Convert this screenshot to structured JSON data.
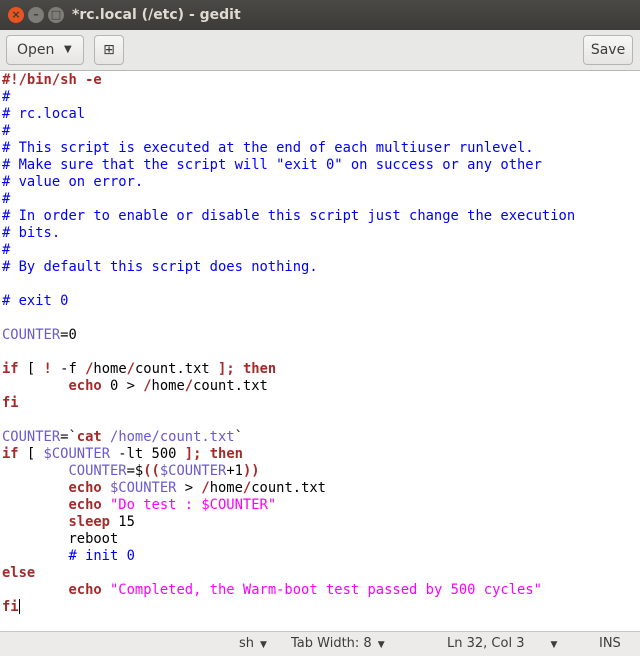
{
  "window": {
    "title": "*rc.local (/etc) - gedit",
    "close_glyph": "×",
    "min_glyph": "–",
    "max_glyph": "□"
  },
  "headerbar": {
    "open_label": "Open",
    "open_arrow": "▼",
    "new_tab_glyph": "⊞",
    "save_label": "Save"
  },
  "editor": {
    "lines": [
      [
        {
          "t": "#!/bin/sh -e",
          "c": "keyword"
        }
      ],
      [
        {
          "t": "#",
          "c": "comment"
        }
      ],
      [
        {
          "t": "# rc.local",
          "c": "comment"
        }
      ],
      [
        {
          "t": "#",
          "c": "comment"
        }
      ],
      [
        {
          "t": "# This script is executed at the end of each multiuser runlevel.",
          "c": "comment"
        }
      ],
      [
        {
          "t": "# Make sure that the script will \"exit 0\" on success or any other",
          "c": "comment"
        }
      ],
      [
        {
          "t": "# value on error.",
          "c": "comment"
        }
      ],
      [
        {
          "t": "#",
          "c": "comment"
        }
      ],
      [
        {
          "t": "# In order to enable or disable this script just change the execution",
          "c": "comment"
        }
      ],
      [
        {
          "t": "# bits.",
          "c": "comment"
        }
      ],
      [
        {
          "t": "#",
          "c": "comment"
        }
      ],
      [
        {
          "t": "# By default this script does nothing.",
          "c": "comment"
        }
      ],
      [],
      [
        {
          "t": "# exit 0",
          "c": "comment"
        }
      ],
      [],
      [
        {
          "t": "COUNTER",
          "c": "variable"
        },
        {
          "t": "=0",
          "c": "plain"
        }
      ],
      [],
      [
        {
          "t": "if",
          "c": "keyword"
        },
        {
          "t": " [ ",
          "c": "plain"
        },
        {
          "t": "!",
          "c": "keyword"
        },
        {
          "t": " -f ",
          "c": "plain"
        },
        {
          "t": "/",
          "c": "keyword"
        },
        {
          "t": "home",
          "c": "plain"
        },
        {
          "t": "/",
          "c": "keyword"
        },
        {
          "t": "count.txt ",
          "c": "plain"
        },
        {
          "t": "];",
          "c": "keyword"
        },
        {
          "t": " ",
          "c": "plain"
        },
        {
          "t": "then",
          "c": "keyword"
        }
      ],
      [
        {
          "t": "        ",
          "c": "plain"
        },
        {
          "t": "echo",
          "c": "keyword"
        },
        {
          "t": " 0 > ",
          "c": "plain"
        },
        {
          "t": "/",
          "c": "keyword"
        },
        {
          "t": "home",
          "c": "plain"
        },
        {
          "t": "/",
          "c": "keyword"
        },
        {
          "t": "count.txt",
          "c": "plain"
        }
      ],
      [
        {
          "t": "fi",
          "c": "keyword"
        }
      ],
      [],
      [
        {
          "t": "COUNTER",
          "c": "variable"
        },
        {
          "t": "=`",
          "c": "plain"
        },
        {
          "t": "cat",
          "c": "keyword"
        },
        {
          "t": " /home/count.txt",
          "c": "variable"
        },
        {
          "t": "`",
          "c": "plain"
        }
      ],
      [
        {
          "t": "if",
          "c": "keyword"
        },
        {
          "t": " [ ",
          "c": "plain"
        },
        {
          "t": "$COUNTER",
          "c": "variable"
        },
        {
          "t": " -lt 500 ",
          "c": "plain"
        },
        {
          "t": "];",
          "c": "keyword"
        },
        {
          "t": " ",
          "c": "plain"
        },
        {
          "t": "then",
          "c": "keyword"
        }
      ],
      [
        {
          "t": "        ",
          "c": "plain"
        },
        {
          "t": "COUNTER",
          "c": "variable"
        },
        {
          "t": "=$",
          "c": "plain"
        },
        {
          "t": "((",
          "c": "keyword"
        },
        {
          "t": "$COUNTER",
          "c": "variable"
        },
        {
          "t": "+1",
          "c": "plain"
        },
        {
          "t": "))",
          "c": "keyword"
        }
      ],
      [
        {
          "t": "        ",
          "c": "plain"
        },
        {
          "t": "echo",
          "c": "keyword"
        },
        {
          "t": " ",
          "c": "plain"
        },
        {
          "t": "$COUNTER",
          "c": "variable"
        },
        {
          "t": " > ",
          "c": "plain"
        },
        {
          "t": "/",
          "c": "keyword"
        },
        {
          "t": "home",
          "c": "plain"
        },
        {
          "t": "/",
          "c": "keyword"
        },
        {
          "t": "count.txt",
          "c": "plain"
        }
      ],
      [
        {
          "t": "        ",
          "c": "plain"
        },
        {
          "t": "echo",
          "c": "keyword"
        },
        {
          "t": " ",
          "c": "plain"
        },
        {
          "t": "\"Do test : $COUNTER\"",
          "c": "string"
        }
      ],
      [
        {
          "t": "        ",
          "c": "plain"
        },
        {
          "t": "sleep",
          "c": "keyword"
        },
        {
          "t": " 15",
          "c": "plain"
        }
      ],
      [
        {
          "t": "        reboot",
          "c": "plain"
        }
      ],
      [
        {
          "t": "        ",
          "c": "plain"
        },
        {
          "t": "# init 0",
          "c": "comment"
        }
      ],
      [
        {
          "t": "else",
          "c": "keyword"
        }
      ],
      [
        {
          "t": "        ",
          "c": "plain"
        },
        {
          "t": "echo",
          "c": "keyword"
        },
        {
          "t": " ",
          "c": "plain"
        },
        {
          "t": "\"Completed, the Warm-boot test passed by 500 cycles\"",
          "c": "string"
        }
      ],
      [
        {
          "t": "fi",
          "c": "keyword"
        }
      ]
    ]
  },
  "statusbar": {
    "language": "sh",
    "tab_width": "Tab Width: 8",
    "position": "Ln 32, Col 3",
    "mode": "INS",
    "arrow": "▼"
  }
}
